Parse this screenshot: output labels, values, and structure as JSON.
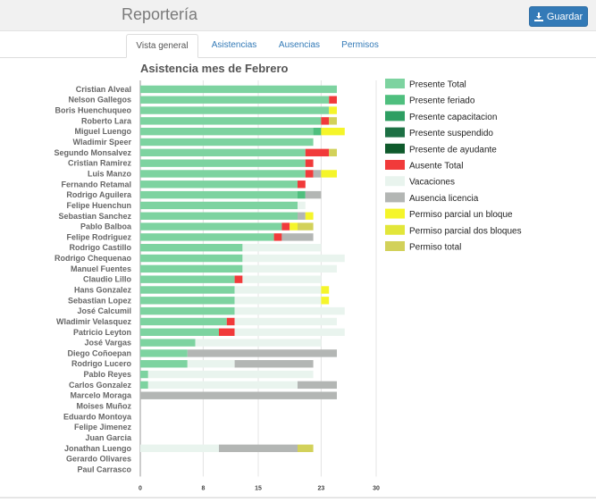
{
  "header": {
    "title": "Reportería",
    "save_label": "Guardar"
  },
  "tabs": [
    {
      "label": "Vista general",
      "active": true
    },
    {
      "label": "Asistencias",
      "active": false
    },
    {
      "label": "Ausencias",
      "active": false
    },
    {
      "label": "Permisos",
      "active": false
    }
  ],
  "chart_data": {
    "type": "bar",
    "orientation": "horizontal",
    "stacked": true,
    "title": "Asistencia mes de Febrero",
    "xlim": [
      0,
      30
    ],
    "xticks": [
      "0",
      "8",
      "15",
      "23",
      "30"
    ],
    "grid": true,
    "legend_position": "right",
    "categories": [
      "Cristian Alveal",
      "Nelson Gallegos",
      "Boris Huenchuqueo",
      "Roberto Lara",
      "Miguel Luengo",
      "Wladimir Speer",
      "Segundo Monsalvez",
      "Cristian Ramirez",
      "Luis Manzo",
      "Fernando Retamal",
      "Rodrigo Aguilera",
      "Felipe Huenchun",
      "Sebastian Sanchez",
      "Pablo Balboa",
      "Felipe Rodriguez",
      "Rodrigo Castillo",
      "Rodrigo Chequenao",
      "Manuel Fuentes",
      "Claudio Lillo",
      "Hans Gonzalez",
      "Sebastian Lopez",
      "José Calcumil",
      "Wladimir Velasquez",
      "Patricio Leyton",
      "José Vargas",
      "Diego Coñoepan",
      "Rodrigo Lucero",
      "Pablo Reyes",
      "Carlos Gonzalez",
      "Marcelo Moraga",
      "Moises Muñoz",
      "Eduardo Montoya",
      "Felipe Jimenez",
      "Juan Garcia",
      "Jonathan Luengo",
      "Gerardo Olivares",
      "Paul Carrasco"
    ],
    "series": [
      {
        "name": "Presente Total",
        "color": "#7dd3a0",
        "values": [
          25,
          24,
          24,
          23,
          22,
          22,
          21,
          21,
          21,
          20,
          20,
          20,
          20,
          18,
          17,
          13,
          13,
          13,
          12,
          12,
          12,
          12,
          11,
          10,
          7,
          6,
          6,
          1,
          1,
          0,
          0,
          0,
          0,
          0,
          0,
          0,
          0
        ]
      },
      {
        "name": "Presente feriado",
        "color": "#4fbf7e",
        "values": [
          0,
          0,
          0,
          0,
          1,
          0,
          0,
          0,
          0,
          0,
          1,
          0,
          0,
          0,
          0,
          0,
          0,
          0,
          0,
          0,
          0,
          0,
          0,
          0,
          0,
          0,
          0,
          0,
          0,
          0,
          0,
          0,
          0,
          0,
          0,
          0,
          0
        ]
      },
      {
        "name": "Presente capacitacion",
        "color": "#2e9e62",
        "values": [
          0,
          0,
          0,
          0,
          0,
          0,
          0,
          0,
          0,
          0,
          0,
          0,
          0,
          0,
          0,
          0,
          0,
          0,
          0,
          0,
          0,
          0,
          0,
          0,
          0,
          0,
          0,
          0,
          0,
          0,
          0,
          0,
          0,
          0,
          0,
          0,
          0
        ]
      },
      {
        "name": "Presente suspendido",
        "color": "#1d7044",
        "values": [
          0,
          0,
          0,
          0,
          0,
          0,
          0,
          0,
          0,
          0,
          0,
          0,
          0,
          0,
          0,
          0,
          0,
          0,
          0,
          0,
          0,
          0,
          0,
          0,
          0,
          0,
          0,
          0,
          0,
          0,
          0,
          0,
          0,
          0,
          0,
          0,
          0
        ]
      },
      {
        "name": "Presente de ayudante",
        "color": "#0f5a2c",
        "values": [
          0,
          0,
          0,
          0,
          0,
          0,
          0,
          0,
          0,
          0,
          0,
          0,
          0,
          0,
          0,
          0,
          0,
          0,
          0,
          0,
          0,
          0,
          0,
          0,
          0,
          0,
          0,
          0,
          0,
          0,
          0,
          0,
          0,
          0,
          0,
          0,
          0
        ]
      },
      {
        "name": "Ausente Total",
        "color": "#f13a3a",
        "values": [
          0,
          1,
          0,
          1,
          0,
          0,
          3,
          1,
          1,
          1,
          0,
          0,
          0,
          1,
          1,
          0,
          0,
          0,
          1,
          0,
          0,
          0,
          1,
          2,
          0,
          0,
          0,
          0,
          0,
          0,
          0,
          0,
          0,
          0,
          0,
          0,
          0
        ]
      },
      {
        "name": "Vacaciones",
        "color": "#e9f4ee",
        "values": [
          0,
          0,
          0,
          0,
          0,
          0,
          0,
          0,
          0,
          0,
          0,
          1,
          0,
          0,
          0,
          10,
          13,
          12,
          10,
          11,
          11,
          14,
          13,
          14,
          16,
          0,
          6,
          21,
          19,
          0,
          0,
          0,
          0,
          0,
          10,
          0,
          0
        ]
      },
      {
        "name": "Ausencia licencia",
        "color": "#b3b6b4",
        "values": [
          0,
          0,
          0,
          0,
          0,
          0,
          0,
          0,
          1,
          0,
          2,
          0,
          1,
          0,
          4,
          0,
          0,
          0,
          0,
          0,
          0,
          0,
          0,
          0,
          0,
          19,
          10,
          0,
          5,
          25,
          0,
          0,
          0,
          0,
          10,
          0,
          0
        ]
      },
      {
        "name": "Permiso parcial un bloque",
        "color": "#f5f52a",
        "values": [
          0,
          0,
          1,
          0,
          3,
          0,
          0,
          0,
          2,
          0,
          0,
          0,
          1,
          1,
          0,
          0,
          0,
          0,
          0,
          1,
          1,
          0,
          0,
          0,
          0,
          0,
          0,
          0,
          0,
          0,
          0,
          0,
          0,
          0,
          0,
          0,
          0
        ]
      },
      {
        "name": "Permiso parcial dos bloques",
        "color": "#e2e63a",
        "values": [
          0,
          0,
          0,
          0,
          0,
          0,
          0,
          0,
          0,
          0,
          0,
          0,
          0,
          0,
          0,
          0,
          0,
          0,
          0,
          0,
          0,
          0,
          0,
          0,
          0,
          0,
          0,
          0,
          0,
          0,
          0,
          0,
          0,
          0,
          0,
          0,
          0
        ]
      },
      {
        "name": "Permiso total",
        "color": "#d2d15a",
        "values": [
          0,
          0,
          0,
          1,
          0,
          0,
          1,
          0,
          0,
          0,
          0,
          0,
          0,
          2,
          0,
          0,
          0,
          0,
          0,
          0,
          0,
          0,
          0,
          0,
          0,
          0,
          0,
          0,
          0,
          0,
          0,
          0,
          0,
          0,
          2,
          0,
          0
        ]
      }
    ]
  }
}
